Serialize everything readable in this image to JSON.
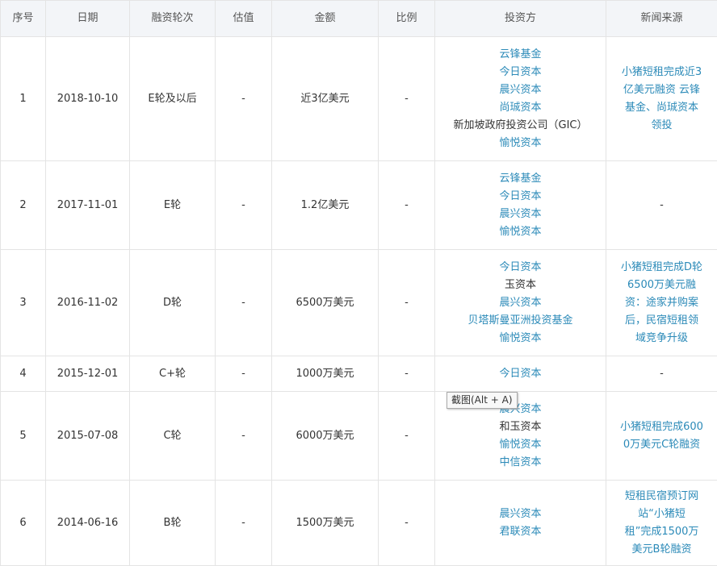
{
  "headers": [
    "序号",
    "日期",
    "融资轮次",
    "估值",
    "金额",
    "比例",
    "投资方",
    "新闻来源"
  ],
  "rows": [
    {
      "seq": "1",
      "date": "2018-10-10",
      "round": "E轮及以后",
      "valuation": "-",
      "amount": "近3亿美元",
      "ratio": "-",
      "investors": [
        {
          "name": "云锋基金",
          "link": true
        },
        {
          "name": "今日资本",
          "link": true
        },
        {
          "name": "晨兴资本",
          "link": true
        },
        {
          "name": "尚珹资本",
          "link": true
        },
        {
          "name": "新加坡政府投资公司（GIC）",
          "link": false
        },
        {
          "name": "愉悦资本",
          "link": true
        }
      ],
      "news_lines": [
        "小猪短租完成近3",
        "亿美元融资 云锋",
        "基金、尚珹资本",
        "领投"
      ]
    },
    {
      "seq": "2",
      "date": "2017-11-01",
      "round": "E轮",
      "valuation": "-",
      "amount": "1.2亿美元",
      "ratio": "-",
      "investors": [
        {
          "name": "云锋基金",
          "link": true
        },
        {
          "name": "今日资本",
          "link": true
        },
        {
          "name": "晨兴资本",
          "link": true
        },
        {
          "name": "愉悦资本",
          "link": true
        }
      ],
      "news_lines": [
        "-"
      ]
    },
    {
      "seq": "3",
      "date": "2016-11-02",
      "round": "D轮",
      "valuation": "-",
      "amount": "6500万美元",
      "ratio": "-",
      "investors": [
        {
          "name": "今日资本",
          "link": true
        },
        {
          "name": "玉资本",
          "link": false
        },
        {
          "name": "晨兴资本",
          "link": true
        },
        {
          "name": "贝塔斯曼亚洲投资基金",
          "link": true
        },
        {
          "name": "愉悦资本",
          "link": true
        }
      ],
      "news_lines": [
        "小猪短租完成D轮",
        "6500万美元融",
        "资：途家并购案",
        "后，民宿短租领",
        "域竞争升级"
      ]
    },
    {
      "seq": "4",
      "date": "2015-12-01",
      "round": "C+轮",
      "valuation": "-",
      "amount": "1000万美元",
      "ratio": "-",
      "investors": [
        {
          "name": "今日资本",
          "link": true
        }
      ],
      "news_lines": [
        "-"
      ]
    },
    {
      "seq": "5",
      "date": "2015-07-08",
      "round": "C轮",
      "valuation": "-",
      "amount": "6000万美元",
      "ratio": "-",
      "investors": [
        {
          "name": "晨兴资本",
          "link": true
        },
        {
          "name": "和玉资本",
          "link": false
        },
        {
          "name": "愉悦资本",
          "link": true
        },
        {
          "name": "中信资本",
          "link": true
        }
      ],
      "news_lines": [
        "小猪短租完成600",
        "0万美元C轮融资"
      ]
    },
    {
      "seq": "6",
      "date": "2014-06-16",
      "round": "B轮",
      "valuation": "-",
      "amount": "1500万美元",
      "ratio": "-",
      "investors": [
        {
          "name": "晨兴资本",
          "link": true
        },
        {
          "name": "君联资本",
          "link": true
        }
      ],
      "news_lines": [
        "短租民宿预订网",
        "站“小猪短",
        "租”完成1500万",
        "美元B轮融资"
      ]
    }
  ],
  "tooltip": "截图(Alt + A)",
  "colors": {
    "link": "#2b8ab8",
    "header_bg": "#f3f5f8",
    "border": "#e4e4e4"
  }
}
